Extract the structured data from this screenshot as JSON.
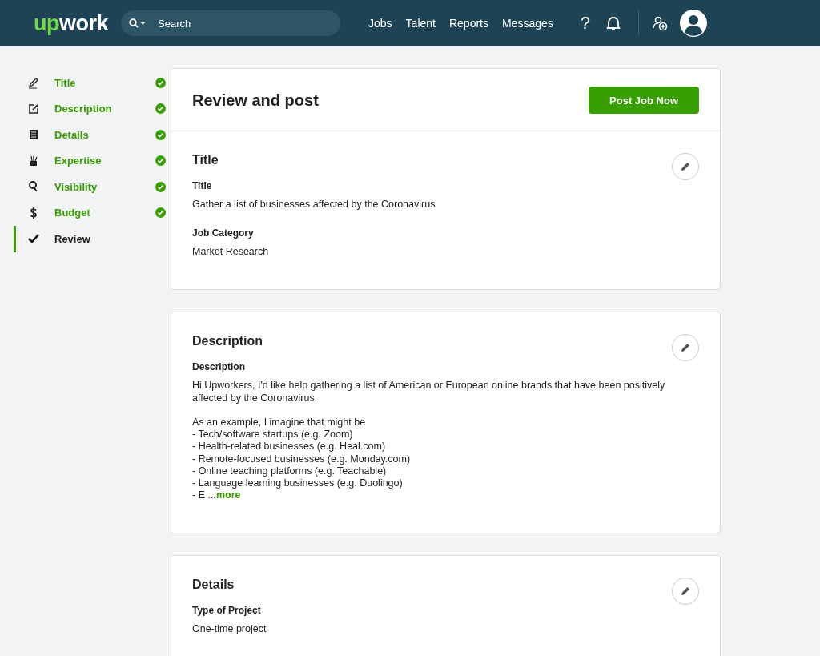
{
  "header": {
    "logo": {
      "accent": "up",
      "rest": "work"
    },
    "search": {
      "placeholder": "Search"
    },
    "nav": [
      "Jobs",
      "Talent",
      "Reports",
      "Messages"
    ],
    "help": "?"
  },
  "sidebar": {
    "items": [
      {
        "label": "Title",
        "done": true,
        "selected": false
      },
      {
        "label": "Description",
        "done": true,
        "selected": false
      },
      {
        "label": "Details",
        "done": true,
        "selected": false
      },
      {
        "label": "Expertise",
        "done": true,
        "selected": false
      },
      {
        "label": "Visibility",
        "done": true,
        "selected": false
      },
      {
        "label": "Budget",
        "done": true,
        "selected": false
      },
      {
        "label": "Review",
        "done": false,
        "selected": true
      }
    ]
  },
  "review": {
    "title": "Review and post",
    "button": "Post Job Now"
  },
  "sections": [
    {
      "title": "Title",
      "fields": [
        {
          "label": "Title",
          "value": "Gather a list of businesses affected by the Coronavirus"
        },
        {
          "label": "Job Category",
          "value": "Market Research"
        }
      ]
    },
    {
      "title": "Description",
      "fields": [
        {
          "label": "Description",
          "value": "Hi Upworkers, I'd like help gathering a list of American or European online brands that have been positively affected by the Coronavirus.\n\nAs an example, I imagine that might be\n- Tech/software startups (e.g. Zoom)\n- Health-related businesses (e.g. Heal.com)\n- Remote-focused businesses (e.g. Monday.com)\n- Online teaching platforms (e.g. Teachable)\n- Language learning businesses (e.g. Duolingo)\n- E ...",
          "more": "more"
        }
      ]
    },
    {
      "title": "Details",
      "fields": [
        {
          "label": "Type of Project",
          "value": "One-time project"
        }
      ]
    }
  ]
}
